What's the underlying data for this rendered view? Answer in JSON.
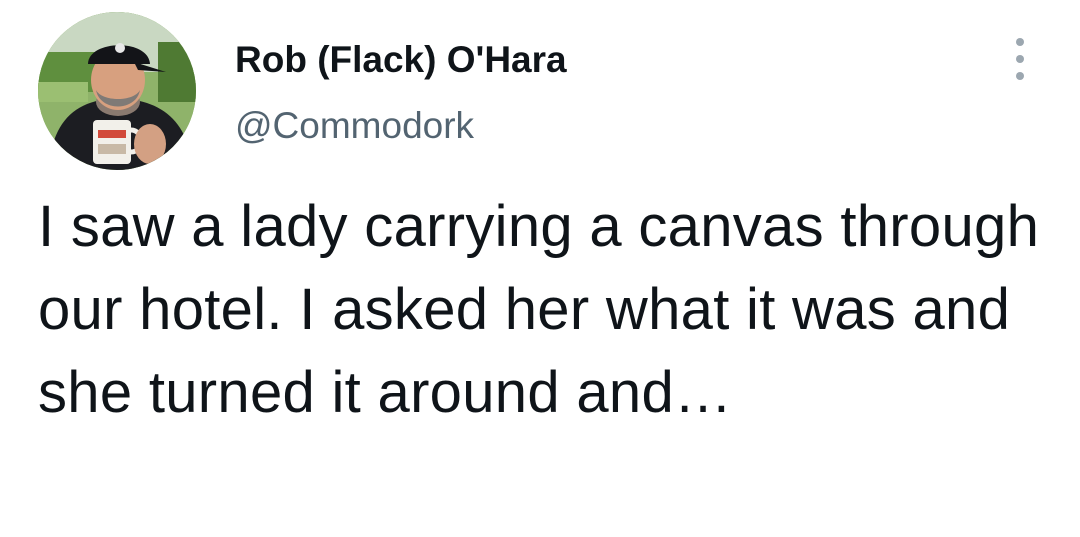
{
  "author": {
    "name": "Rob (Flack) O'Hara",
    "handle": "@Commodork",
    "avatar_icon": "profile-photo-man-with-coffee-mug"
  },
  "menu": {
    "icon": "more-vertical-icon"
  },
  "tweet": {
    "text": "I saw a lady carrying a canvas through our hotel. I asked her what it was and she turned it around and…"
  },
  "colors": {
    "text_primary": "#0f1419",
    "text_secondary": "#536471",
    "menu_dots": "#9ca7b0",
    "background": "#ffffff"
  }
}
